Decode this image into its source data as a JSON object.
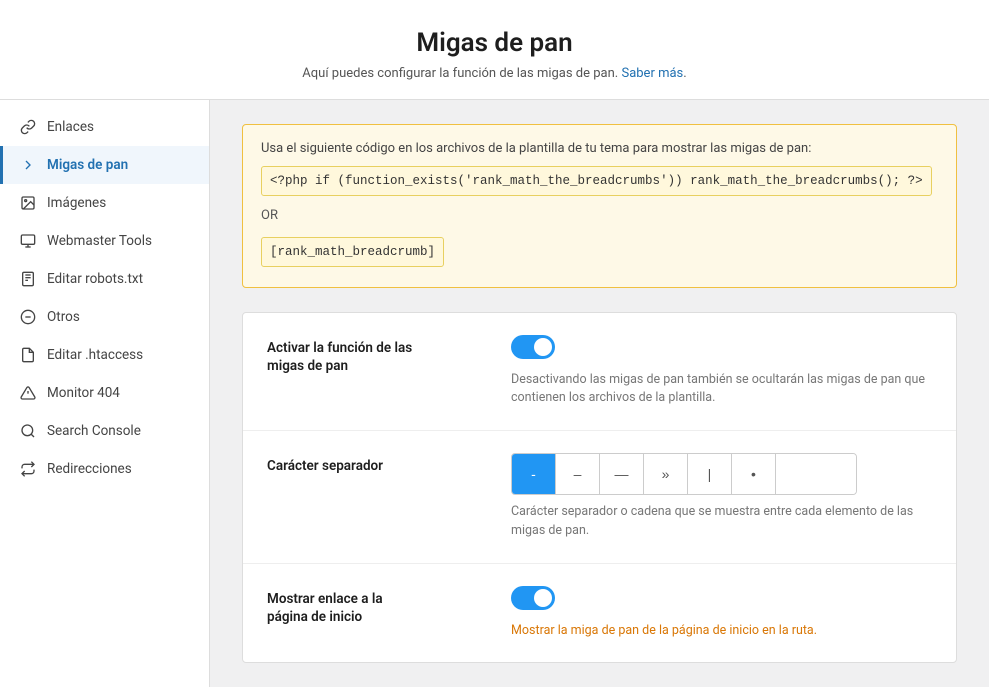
{
  "header": {
    "title": "Migas de pan",
    "subtitle": "Aquí puedes configurar la función de las migas de pan.",
    "link_text": "Saber más",
    "link_href": "#"
  },
  "sidebar": {
    "items": [
      {
        "id": "enlaces",
        "label": "Enlaces",
        "active": false,
        "icon": "link"
      },
      {
        "id": "migas-de-pan",
        "label": "Migas de pan",
        "active": true,
        "icon": "breadcrumb"
      },
      {
        "id": "imagenes",
        "label": "Imágenes",
        "active": false,
        "icon": "images"
      },
      {
        "id": "webmaster-tools",
        "label": "Webmaster Tools",
        "active": false,
        "icon": "webmaster"
      },
      {
        "id": "editar-robots",
        "label": "Editar robots.txt",
        "active": false,
        "icon": "robots"
      },
      {
        "id": "otros",
        "label": "Otros",
        "active": false,
        "icon": "otros"
      },
      {
        "id": "editar-htaccess",
        "label": "Editar .htaccess",
        "active": false,
        "icon": "htaccess"
      },
      {
        "id": "monitor-404",
        "label": "Monitor 404",
        "active": false,
        "icon": "monitor"
      },
      {
        "id": "search-console",
        "label": "Search Console",
        "active": false,
        "icon": "search-console"
      },
      {
        "id": "redirecciones",
        "label": "Redirecciones",
        "active": false,
        "icon": "redirecciones"
      }
    ]
  },
  "info_box": {
    "text": "Usa el siguiente código en los archivos de la plantilla de tu tema para mostrar las migas de pan:",
    "code1": "<?php if (function_exists('rank_math_the_breadcrumbs')) rank_math_the_breadcrumbs(); ?>",
    "or": "OR",
    "code2": "[rank_math_breadcrumb]"
  },
  "sections": [
    {
      "id": "activar-funcion",
      "label": "Activar la función de las\nmigas de pan",
      "toggle_on": true,
      "desc": "Desactivando las migas de pan también se ocultarán las migas de pan que contienen los archivos de la plantilla.",
      "desc_color": "gray"
    },
    {
      "id": "caracter-separador",
      "label": "Carácter separador",
      "toggle_on": null,
      "desc": "Carácter separador o cadena que se muestra entre cada elemento de las migas de pan.",
      "desc_color": "gray",
      "separators": [
        "-",
        "–",
        "—",
        "»",
        "|",
        "•"
      ],
      "active_separator": 0
    },
    {
      "id": "mostrar-enlace",
      "label": "Mostrar enlace a la\npágina de inicio",
      "toggle_on": true,
      "desc": "Mostrar la miga de pan de la página de inicio en la ruta.",
      "desc_color": "orange"
    }
  ]
}
